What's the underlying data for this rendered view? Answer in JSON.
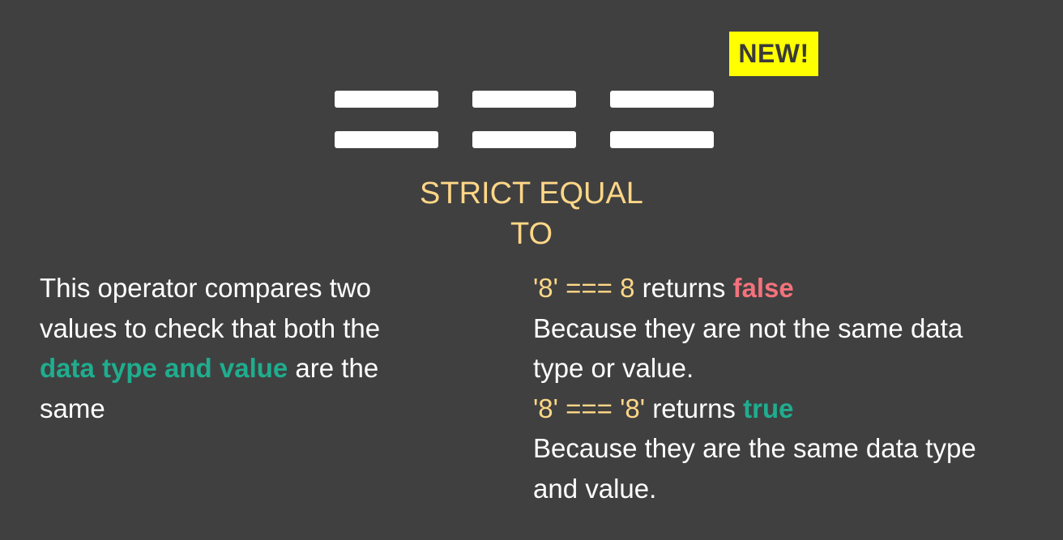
{
  "badge": {
    "label": "NEW!"
  },
  "title": {
    "line1": "STRICT EQUAL",
    "line2": "TO"
  },
  "description": {
    "line1": "This operator compares two",
    "line2": "values to check that both the",
    "highlight": "data type and value",
    "line3_rest": " are the",
    "line4": "same"
  },
  "examples": [
    {
      "code": "'8' === 8",
      "returns": " returns ",
      "result": "false",
      "explanation_line1": "Because they are not the same data",
      "explanation_line2": "type or value."
    },
    {
      "code": "'8' === '8'",
      "returns": " returns ",
      "result": "true",
      "explanation_line1": "Because they are the same data type",
      "explanation_line2": "and value."
    }
  ],
  "colors": {
    "background": "#404040",
    "badge": "#ffff00",
    "title": "#ffd787",
    "false": "#f4727c",
    "true": "#1fad8e"
  }
}
